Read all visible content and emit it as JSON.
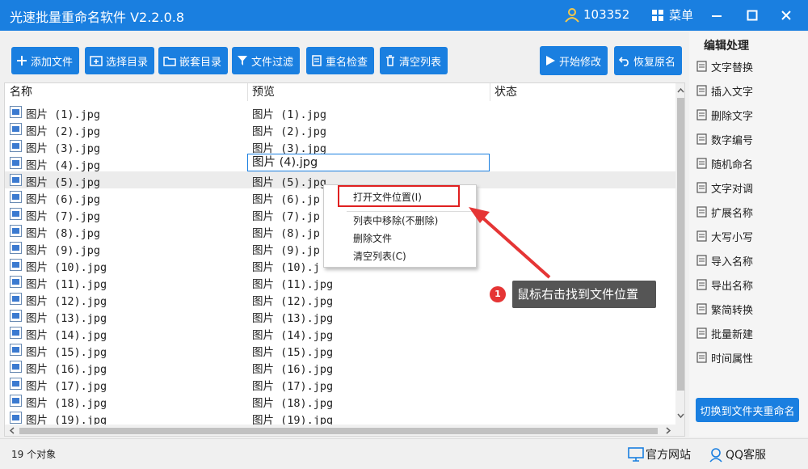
{
  "app": {
    "title": "光速批量重命名软件 V2.2.0.8",
    "user_id": "103352",
    "menu_label": "菜单"
  },
  "toolbar": {
    "add_file": "添加文件",
    "select_dir": "选择目录",
    "nested_dir": "嵌套目录",
    "file_filter": "文件过滤",
    "rename_check": "重名检查",
    "clear_list": "清空列表",
    "start_modify": "开始修改",
    "restore_name": "恢复原名"
  },
  "list": {
    "columns": [
      "名称",
      "预览",
      "状态"
    ],
    "rows": [
      {
        "name": "图片 (1).jpg",
        "preview": "图片 (1).jpg"
      },
      {
        "name": "图片 (2).jpg",
        "preview": "图片 (2).jpg"
      },
      {
        "name": "图片 (3).jpg",
        "preview": "图片 (3).jpg"
      },
      {
        "name": "图片 (4).jpg",
        "preview": "图片 (4).jpg"
      },
      {
        "name": "图片 (5).jpg",
        "preview": "图片 (5).jpg"
      },
      {
        "name": "图片 (6).jpg",
        "preview": "图片 (6).jp"
      },
      {
        "name": "图片 (7).jpg",
        "preview": "图片 (7).jp"
      },
      {
        "name": "图片 (8).jpg",
        "preview": "图片 (8).jp"
      },
      {
        "name": "图片 (9).jpg",
        "preview": "图片 (9).jp"
      },
      {
        "name": "图片 (10).jpg",
        "preview": "图片 (10).j"
      },
      {
        "name": "图片 (11).jpg",
        "preview": "图片 (11).jpg"
      },
      {
        "name": "图片 (12).jpg",
        "preview": "图片 (12).jpg"
      },
      {
        "name": "图片 (13).jpg",
        "preview": "图片 (13).jpg"
      },
      {
        "name": "图片 (14).jpg",
        "preview": "图片 (14).jpg"
      },
      {
        "name": "图片 (15).jpg",
        "preview": "图片 (15).jpg"
      },
      {
        "name": "图片 (16).jpg",
        "preview": "图片 (16).jpg"
      },
      {
        "name": "图片 (17).jpg",
        "preview": "图片 (17).jpg"
      },
      {
        "name": "图片 (18).jpg",
        "preview": "图片 (18).jpg"
      },
      {
        "name": "图片 (19).jpg",
        "preview": "图片 (19).jpg"
      }
    ],
    "edit_value": "图片 (4).jpg"
  },
  "context_menu": {
    "open_location": "打开文件位置(I)",
    "remove_from_list": "列表中移除(不删除)",
    "delete_file": "删除文件",
    "clear_list": "清空列表(C)"
  },
  "annotation": {
    "step": "1",
    "text": "鼠标右击找到文件位置"
  },
  "right_panel": {
    "title": "编辑处理",
    "items": [
      "文字替换",
      "插入文字",
      "删除文字",
      "数字编号",
      "随机命名",
      "文字对调",
      "扩展名称",
      "大写小写",
      "导入名称",
      "导出名称",
      "繁简转换",
      "批量新建",
      "时间属性"
    ],
    "switch_button": "切换到文件夹重命名"
  },
  "status": {
    "count": "19 个对象",
    "website": "官方网站",
    "qq": "QQ客服"
  },
  "colors": {
    "accent": "#1a7fe0",
    "highlight": "#e02020"
  }
}
